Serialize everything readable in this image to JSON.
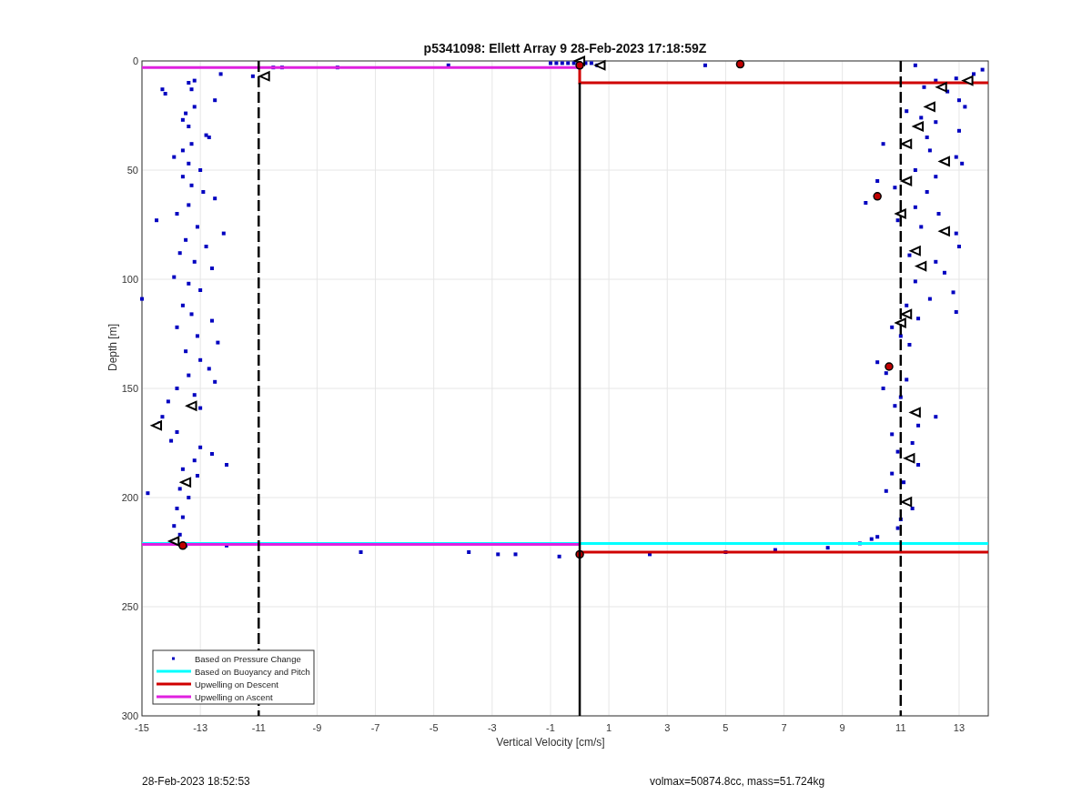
{
  "figure": {
    "chart_data": {
      "type": "scatter",
      "title": "p5341098: Ellett Array 9 28-Feb-2023 17:18:59Z",
      "xlabel": "Vertical Velocity [cm/s]",
      "ylabel": "Depth [m]",
      "xlim": [
        -15,
        14
      ],
      "ylim": [
        300,
        0
      ],
      "xticks": [
        -15,
        -13,
        -11,
        -9,
        -7,
        -5,
        -3,
        -1,
        1,
        3,
        5,
        7,
        9,
        11,
        13
      ],
      "yticks": [
        0,
        50,
        100,
        150,
        200,
        250,
        300
      ],
      "grid": true,
      "legend": true,
      "series": [
        {
          "name": "Based on Pressure Change",
          "color": "#0000c0",
          "marker": "square",
          "x": [
            -14.3,
            -14.2,
            -13.4,
            -13.3,
            -13.2,
            -12.5,
            -13.2,
            -13.5,
            -13.6,
            -13.4,
            -12.8,
            -12.7,
            -13.3,
            -13.6,
            -13.9,
            -13.4,
            -13.0,
            -13.6,
            -13.3,
            -12.9,
            -12.5,
            -13.4,
            -13.8,
            -14.5,
            -13.1,
            -12.2,
            -13.5,
            -12.8,
            -13.7,
            -13.2,
            -12.6,
            -13.9,
            -13.4,
            -13.0,
            -15,
            -13.6,
            -13.3,
            -12.6,
            -13.8,
            -13.1,
            -12.4,
            -13.5,
            -13.0,
            -12.7,
            -13.4,
            -12.5,
            -13.8,
            -13.2,
            -14.1,
            -13.0,
            -14.3,
            -14.4,
            -13.8,
            -14.0,
            -13.0,
            -12.6,
            -13.2,
            -12.1,
            -13.6,
            -13.1,
            -13.7,
            -14.8,
            -13.4,
            -13.8,
            -13.6,
            -13.9,
            -13.7,
            -12.1,
            -13.5,
            -10.5,
            -10.2,
            -8.3,
            -4.5,
            -1.0,
            -0.8,
            -0.6,
            -0.4,
            -0.2,
            0.2,
            0.4,
            0.6,
            4.3,
            -12.3,
            -11.2,
            11.5,
            13.8,
            13.5,
            12.9,
            12.2,
            11.8,
            12.6,
            13.0,
            13.2,
            11.2,
            11.7,
            12.2,
            13.0,
            11.9,
            10.4,
            12.0,
            12.9,
            13.1,
            11.5,
            12.2,
            10.2,
            10.8,
            11.9,
            9.8,
            11.5,
            12.3,
            10.9,
            11.7,
            12.9,
            13.0,
            11.3,
            12.2,
            12.5,
            11.5,
            12.8,
            12.0,
            11.2,
            12.9,
            11.6,
            10.7,
            11.0,
            11.3,
            10.2,
            10.5,
            11.2,
            10.4,
            11.0,
            10.8,
            12.2,
            11.6,
            10.7,
            11.4,
            10.9,
            11.6,
            10.7,
            11.1,
            10.5,
            11.4,
            11.0,
            10.9,
            10.2,
            9.6,
            8.5,
            -7.5,
            -3.8,
            -2.8,
            -2.2,
            -0.7,
            2.4,
            5.0,
            6.7,
            10.0
          ],
          "values": [
            13,
            15,
            10,
            13,
            9,
            18,
            21,
            24,
            27,
            30,
            34,
            35,
            38,
            41,
            44,
            47,
            50,
            53,
            57,
            60,
            63,
            66,
            70,
            73,
            76,
            79,
            82,
            85,
            88,
            92,
            95,
            99,
            102,
            105,
            109,
            112,
            116,
            119,
            122,
            126,
            129,
            133,
            137,
            141,
            144,
            147,
            150,
            153,
            156,
            159,
            163,
            166,
            170,
            174,
            177,
            180,
            183,
            185,
            187,
            190,
            196,
            198,
            200,
            205,
            209,
            213,
            217,
            222,
            222,
            3,
            3,
            3,
            2,
            1,
            1,
            1,
            1,
            1,
            1,
            1,
            2,
            2,
            6,
            7,
            2,
            4,
            6,
            8,
            9,
            12,
            14,
            18,
            21,
            23,
            26,
            28,
            32,
            35,
            38,
            41,
            44,
            47,
            50,
            53,
            55,
            58,
            60,
            65,
            67,
            70,
            73,
            76,
            79,
            85,
            89,
            92,
            97,
            101,
            106,
            109,
            112,
            115,
            118,
            122,
            126,
            130,
            138,
            143,
            146,
            150,
            154,
            158,
            163,
            167,
            171,
            175,
            179,
            185,
            189,
            193,
            197,
            205,
            210,
            214,
            218,
            221,
            223,
            225,
            225,
            226,
            226,
            227,
            226,
            225,
            224,
            219
          ]
        },
        {
          "name": "Based on Buoyancy and Pitch",
          "color": "#00ffff",
          "type": "line",
          "marker": "none",
          "x": [
            -15,
            14
          ],
          "values": [
            221,
            221
          ]
        },
        {
          "name": "Upwelling on Descent",
          "color": "#d00000",
          "type": "line",
          "marker": "none",
          "x": [
            0,
            0,
            14
          ],
          "values": [
            2,
            10,
            10
          ]
        },
        {
          "name": "Upwelling on Ascent",
          "color": "#e020e0",
          "type": "line",
          "marker": "none",
          "x": [
            -15,
            0
          ],
          "values": [
            3,
            3
          ]
        },
        {
          "color": "#d00000",
          "type": "line",
          "marker": "none",
          "x": [
            0,
            14
          ],
          "values": [
            225,
            225
          ]
        },
        {
          "color": "#e020e0",
          "type": "line",
          "marker": "none",
          "x": [
            -15,
            0
          ],
          "values": [
            221.5,
            221.5
          ]
        },
        {
          "color": "#000000",
          "marker": "triangle",
          "x": [
            0,
            0.7,
            13.3,
            12,
            11.6,
            11.2,
            12.5,
            11.2,
            11,
            12.5,
            11.5,
            11.7,
            11.2,
            11,
            11.5,
            11.3,
            -13.3,
            -14.5,
            -13.5,
            -10.8,
            12.4,
            11.2,
            -13.9
          ],
          "values": [
            0,
            2,
            9,
            21,
            30,
            38,
            46,
            55,
            70,
            78,
            87,
            94,
            116,
            120,
            161,
            182,
            158,
            167,
            193,
            7,
            12,
            202,
            220
          ]
        },
        {
          "color": "#c00000",
          "marker": "circle",
          "x": [
            0,
            5.5,
            10.2,
            10.6,
            -13.6,
            0
          ],
          "values": [
            2,
            1.5,
            62,
            140,
            222,
            226
          ]
        }
      ],
      "ref_lines": [
        {
          "axis": "x",
          "value": 0
        },
        {
          "axis": "x",
          "value": -11
        },
        {
          "axis": "x",
          "value": 11
        }
      ]
    }
  },
  "footer": {
    "timestamp": "28-Feb-2023 18:52:53",
    "parameters": "volmax=50874.8cc, mass=51.724kg"
  }
}
